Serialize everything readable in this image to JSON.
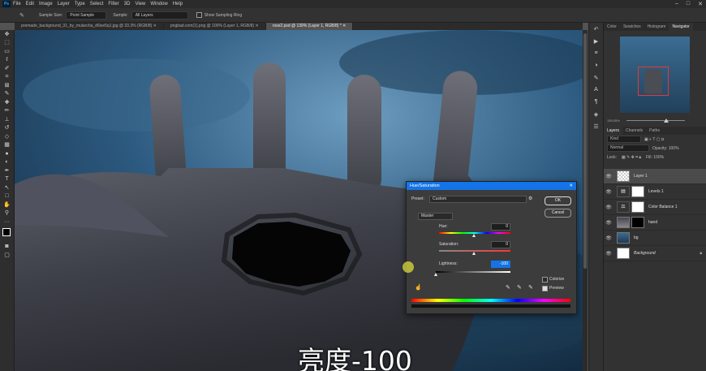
{
  "menubar": {
    "items": [
      "File",
      "Edit",
      "Image",
      "Layer",
      "Type",
      "Select",
      "Filter",
      "3D",
      "View",
      "Window",
      "Help"
    ]
  },
  "options_bar": {
    "sample_size_label": "Sample Size:",
    "sample_size_value": "Point Sample",
    "sample_label": "Sample:",
    "sample_value": "All Layers",
    "show_ring_label": "Show Sampling Ring"
  },
  "tabs": [
    {
      "label": "premade_background_31_by_mularcha_d6ive5q1.jpg @ 33.3% (RGB/8)",
      "active": false
    },
    {
      "label": "pngbad.com(1).png @ 100% (Layer 1, RGB/8)",
      "active": false
    },
    {
      "label": "rose2.psd @ 139% (Layer 1, RGB/8) *",
      "active": true
    }
  ],
  "panels": {
    "top_tabs": [
      "Color",
      "Swatches",
      "Histogram",
      "Navigator"
    ],
    "navigator_zoom": "139.05%",
    "layers_tabs": [
      "Layers",
      "Channels",
      "Paths"
    ],
    "kind_label": "Kind",
    "blend_mode": "Normal",
    "opacity_label": "Opacity: 100%",
    "lock_label": "Lock:",
    "fill_label": "Fill: 100%",
    "layers": [
      {
        "name": "Layer 1",
        "thumb": "check",
        "selected": true
      },
      {
        "name": "Levels 1",
        "thumb": "adj"
      },
      {
        "name": "Color Balance 1",
        "thumb": "adj"
      },
      {
        "name": "hand",
        "thumb": "photo"
      },
      {
        "name": "bg",
        "thumb": "sky"
      },
      {
        "name": "Background",
        "thumb": "white",
        "locked": true
      }
    ]
  },
  "dialog": {
    "title": "Hue/Saturation",
    "preset_label": "Preset:",
    "preset_value": "Custom",
    "channel": "Master",
    "ok_label": "OK",
    "cancel_label": "Cancel",
    "hue_label": "Hue:",
    "hue_value": "0",
    "saturation_label": "Saturation:",
    "saturation_value": "0",
    "lightness_label": "Lightness:",
    "lightness_value": "-100",
    "colorize_label": "Colorize",
    "colorize_checked": false,
    "preview_label": "Preview",
    "preview_checked": true
  },
  "subtitle": "亮度-100",
  "colors": {
    "accent": "#1473e6",
    "app_bg": "#535353",
    "panel_bg": "#323232"
  }
}
